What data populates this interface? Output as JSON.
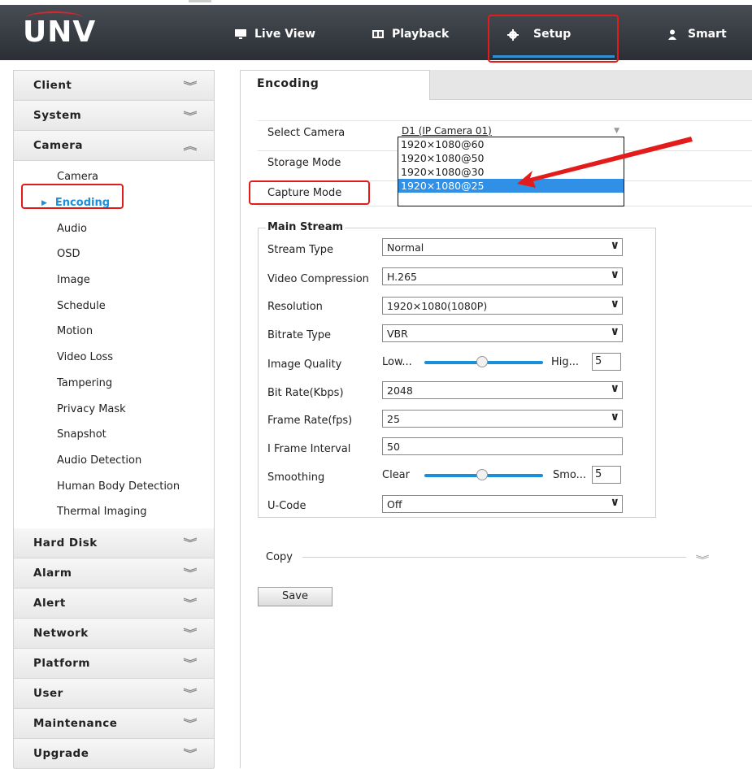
{
  "brand": {
    "logo": "UNV"
  },
  "nav": {
    "live_view": "Live View",
    "playback": "Playback",
    "setup": "Setup",
    "smart": "Smart"
  },
  "sidebar": {
    "sections_top": [
      {
        "label": "Client"
      },
      {
        "label": "System"
      },
      {
        "label": "Camera"
      }
    ],
    "camera_items": [
      "Camera",
      "Encoding",
      "Audio",
      "OSD",
      "Image",
      "Schedule",
      "Motion",
      "Video Loss",
      "Tampering",
      "Privacy Mask",
      "Snapshot",
      "Audio Detection",
      "Human Body Detection",
      "Thermal Imaging"
    ],
    "active_item": "Encoding",
    "sections_bottom": [
      "Hard Disk",
      "Alarm",
      "Alert",
      "Network",
      "Platform",
      "User",
      "Maintenance",
      "Upgrade"
    ]
  },
  "tab": {
    "label": "Encoding"
  },
  "general": {
    "select_camera_label": "Select Camera",
    "select_camera_value": "D1 (IP Camera 01)",
    "storage_mode_label": "Storage Mode",
    "capture_mode_label": "Capture Mode",
    "capture_options": [
      "1920×1080@60",
      "1920×1080@50",
      "1920×1080@30",
      "1920×1080@25"
    ],
    "capture_selected": "1920×1080@25"
  },
  "main_stream": {
    "legend": "Main Stream",
    "stream_type": {
      "label": "Stream Type",
      "value": "Normal"
    },
    "video_compression": {
      "label": "Video Compression",
      "value": "H.265"
    },
    "resolution": {
      "label": "Resolution",
      "value": "1920×1080(1080P)"
    },
    "bitrate_type": {
      "label": "Bitrate Type",
      "value": "VBR"
    },
    "image_quality": {
      "label": "Image Quality",
      "low": "Low...",
      "high": "Hig...",
      "value": "5"
    },
    "bit_rate": {
      "label": "Bit Rate(Kbps)",
      "value": "2048"
    },
    "frame_rate": {
      "label": "Frame Rate(fps)",
      "value": "25"
    },
    "i_frame_interval": {
      "label": "I Frame Interval",
      "value": "50"
    },
    "smoothing": {
      "label": "Smoothing",
      "low": "Clear",
      "high": "Smo...",
      "value": "5"
    },
    "u_code": {
      "label": "U-Code",
      "value": "Off"
    }
  },
  "copy": {
    "label": "Copy"
  },
  "actions": {
    "save": "Save"
  },
  "colors": {
    "accent": "#1b8fd8",
    "highlight": "#e41b1b",
    "topbar": "#3a3f46"
  }
}
